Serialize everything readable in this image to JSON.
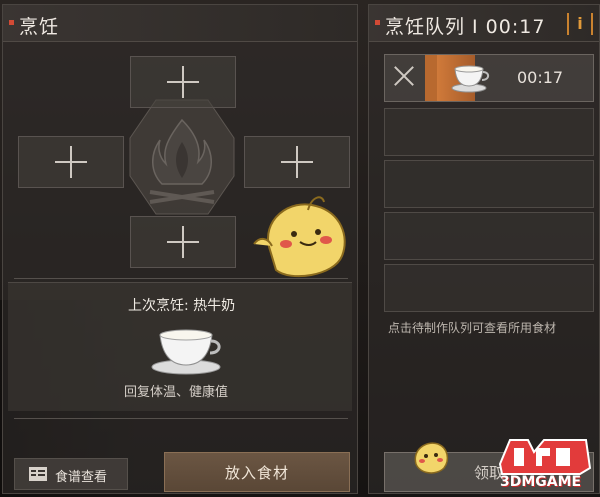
{
  "cooking_panel": {
    "title": "烹饪",
    "ingredient_slots": [
      "top",
      "left",
      "right",
      "bottom"
    ],
    "last_cooked": {
      "label": "上次烹饪: 热牛奶",
      "description": "回复体温、健康值"
    },
    "recipe_button": "食谱查看",
    "cook_button": "放入食材"
  },
  "queue_panel": {
    "title": "烹饪队列 I 00:17",
    "active_item": {
      "time": "00:17",
      "icon": "teacup-icon"
    },
    "empty_slots": 4,
    "hint": "点击待制作队列可查看所用食材",
    "collect_button": "领取"
  },
  "watermark": "3DMGAME",
  "colors": {
    "accent_red": "#d24a35",
    "accent_orange": "#c9822f",
    "panel": "#322e2b"
  }
}
